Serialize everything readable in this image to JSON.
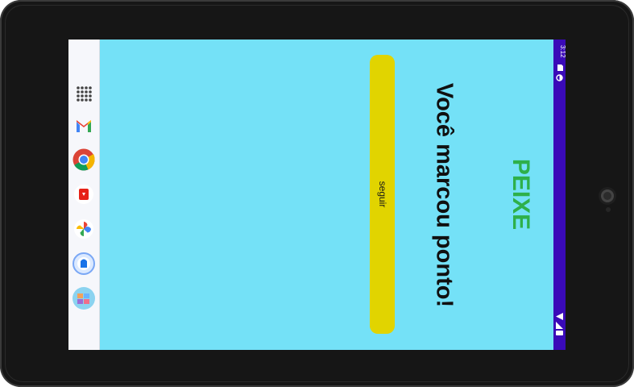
{
  "device": {
    "camera_icon": "front-camera"
  },
  "status_bar": {
    "time": "3:12",
    "left_icons": [
      "sim-card-icon",
      "circle-icon"
    ],
    "right_icons": [
      "wifi-icon",
      "signal-icon",
      "battery-icon"
    ],
    "color": "#3a0ab8"
  },
  "taskbar": {
    "items": [
      {
        "name": "app-drawer",
        "icon": "grid-dots-icon"
      },
      {
        "name": "gmail",
        "icon": "gmail-icon"
      },
      {
        "name": "chrome",
        "icon": "chrome-icon"
      },
      {
        "name": "youtube",
        "icon": "youtube-icon"
      },
      {
        "name": "photos",
        "icon": "photos-pinwheel-icon"
      },
      {
        "name": "assistant-app",
        "icon": "blue-circle-app-icon"
      },
      {
        "name": "game-app",
        "icon": "colorful-app-icon"
      }
    ]
  },
  "app": {
    "background_color": "#74e1f7",
    "title": "PEIXE",
    "title_color": "#2eb04a",
    "message": "Você marcou ponto!",
    "button_label": "seguir",
    "button_color": "#e1d400"
  }
}
